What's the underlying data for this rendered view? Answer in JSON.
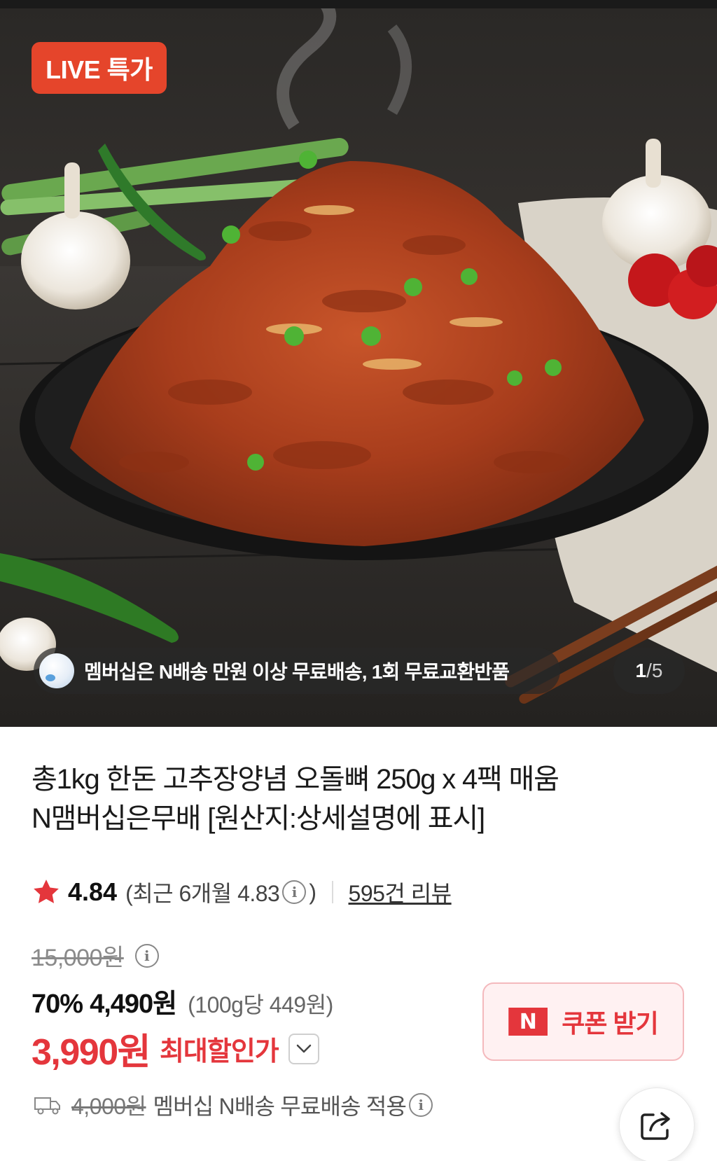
{
  "hero": {
    "badge": "LIVE 특가",
    "notice": "멤버십은 N배송 만원 이상 무료배송, 1회 무료교환반품",
    "counter": {
      "current": "1",
      "separator": "/",
      "total": "5"
    }
  },
  "product": {
    "title_line1": "총1kg 한돈 고추장양념 오돌뼈 250g x 4팩 매움",
    "title_line2": "N맴버십은무배 [원산지:상세설명에 표시]",
    "rating": {
      "score": "4.84",
      "recent_open": "(최근 6개월 4.83",
      "recent_close": ")",
      "review_count": "595건 리뷰"
    },
    "price": {
      "original": "15,000원",
      "discount_rate": "70%",
      "sale": "4,490원",
      "unit": "(100g당 449원)",
      "max_discount": "3,990원",
      "max_discount_label": "최대할인가"
    },
    "coupon": {
      "logo": "N",
      "label": "쿠폰 받기"
    },
    "shipping": {
      "old_fee": "4,000원",
      "text": "멤버십 N배송 무료배송 적용"
    }
  },
  "colors": {
    "badge": "#e5452b",
    "accent_red": "#e4363c",
    "coupon_bg": "#fff1f2"
  },
  "icons": [
    "star-icon",
    "info-icon",
    "chevron-down-icon",
    "truck-icon",
    "share-icon",
    "globe-icon"
  ]
}
